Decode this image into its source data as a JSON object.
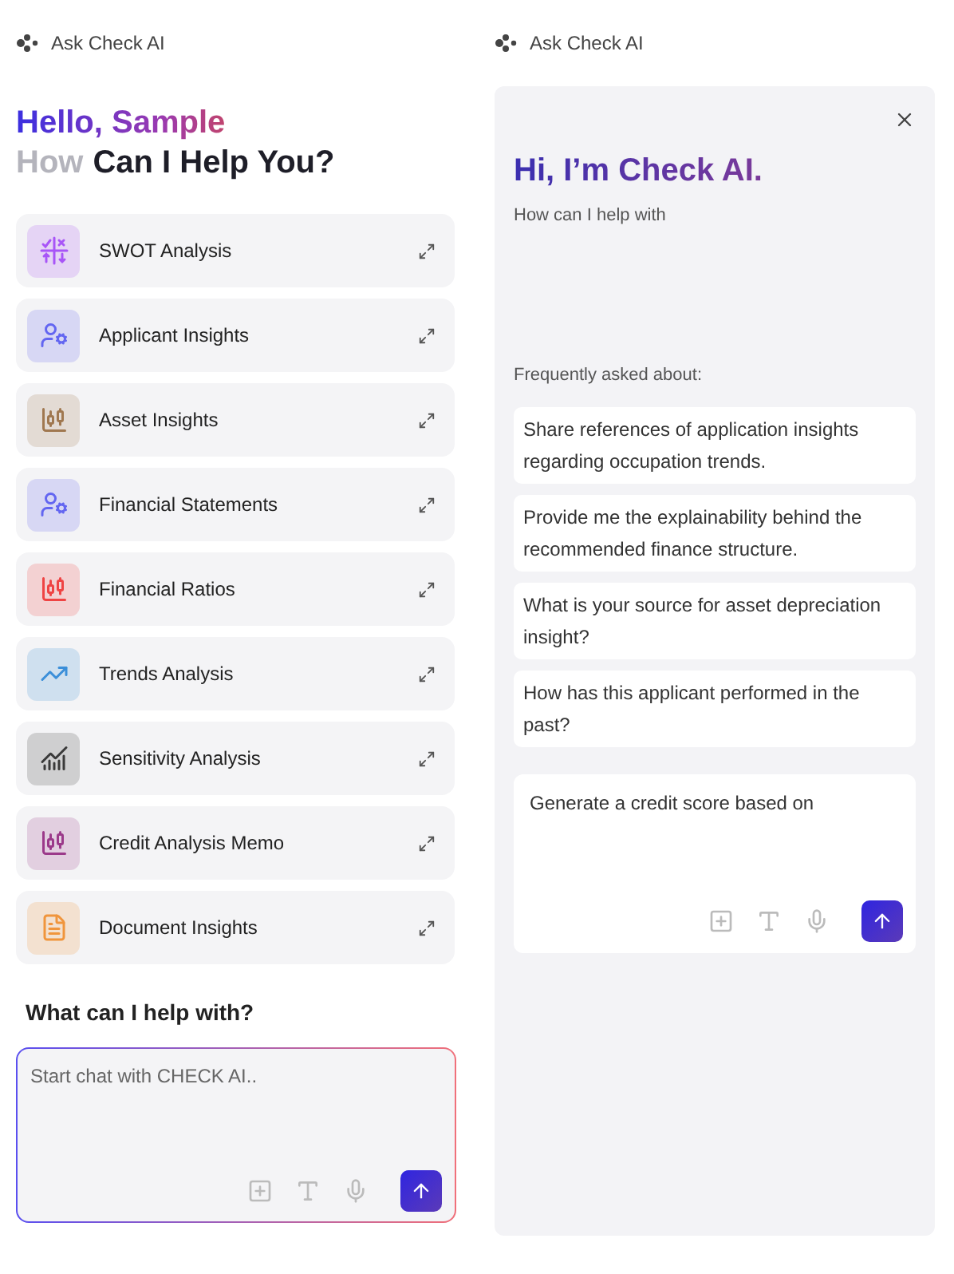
{
  "left": {
    "header": {
      "title": "Ask Check AI"
    },
    "greeting": "Hello, Sample",
    "subtitle_faded": "How",
    "subtitle": "Can I Help You?",
    "items": [
      {
        "label": "SWOT Analysis",
        "kind": "swot",
        "color": "#a855f7"
      },
      {
        "label": "Applicant Insights",
        "kind": "person",
        "color": "#6366f1"
      },
      {
        "label": "Asset Insights",
        "kind": "candles",
        "color": "#a07850"
      },
      {
        "label": "Financial Statements",
        "kind": "person",
        "color": "#6366f1"
      },
      {
        "label": "Financial Ratios",
        "kind": "candles",
        "color": "#ef4444"
      },
      {
        "label": "Trends Analysis",
        "kind": "trend",
        "color": "#3b8fd9"
      },
      {
        "label": "Sensitivity Analysis",
        "kind": "chart",
        "color": "#3a3a3a"
      },
      {
        "label": "Credit Analysis Memo",
        "kind": "candles",
        "color": "#9b3a8a"
      },
      {
        "label": "Document Insights",
        "kind": "document",
        "color": "#f0953c"
      }
    ],
    "prompt_title": "What can I help with?",
    "chat": {
      "placeholder": "Start chat with CHECK AI.."
    }
  },
  "right": {
    "header": {
      "title": "Ask Check AI"
    },
    "panel": {
      "title": "Hi, I’m Check AI.",
      "subtitle": "How can I help with",
      "faq_title": "Frequently asked about:",
      "faqs": [
        "Share references of application insights regarding occupation trends.",
        "Provide me the explainability behind the recommended finance structure.",
        "What is your source for asset depreciation insight?",
        "How has this applicant performed in the past?"
      ],
      "chat": {
        "value": "Generate a credit score based on"
      }
    }
  }
}
